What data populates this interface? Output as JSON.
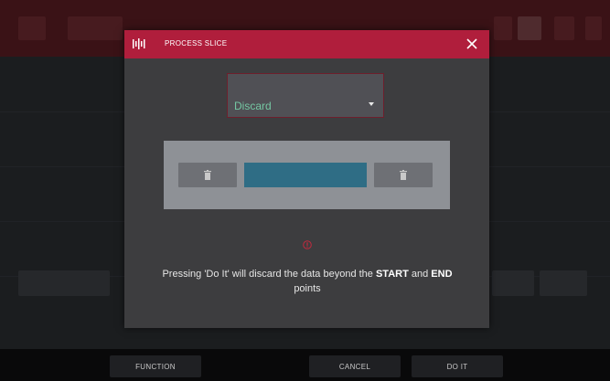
{
  "dialog": {
    "title": "PROCESS SLICE",
    "mode_value": "Discard",
    "message_part1": "Pressing 'Do It' will discard the data beyond the ",
    "message_start": "START",
    "message_and": " and ",
    "message_end": "END",
    "message_part2": " points"
  },
  "softkeys": {
    "function": "FUNCTION",
    "cancel": "CANCEL",
    "doit": "DO IT"
  },
  "icons": {
    "process": "waveform-icon",
    "close": "close-icon",
    "trash": "trash-icon",
    "warning": "warning-icon",
    "dropdown": "chevron-down-icon"
  },
  "colors": {
    "accent": "#b01e3c",
    "value_text": "#74c7a3",
    "slice_bar": "#2f6d85"
  }
}
